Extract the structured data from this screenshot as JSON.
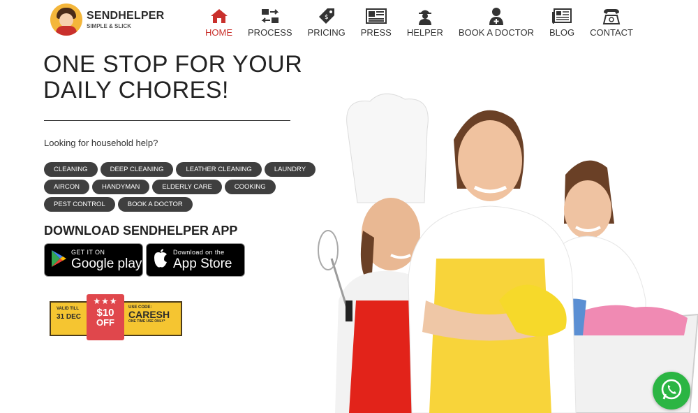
{
  "brand": {
    "name": "SENDHELPER",
    "tagline": "SIMPLE & SLICK"
  },
  "nav": {
    "items": [
      {
        "label": "HOME",
        "icon": "home-icon",
        "active": true
      },
      {
        "label": "PROCESS",
        "icon": "process-icon",
        "active": false
      },
      {
        "label": "PRICING",
        "icon": "price-tag-icon",
        "active": false
      },
      {
        "label": "PRESS",
        "icon": "newspaper-icon",
        "active": false
      },
      {
        "label": "HELPER",
        "icon": "worker-icon",
        "active": false
      },
      {
        "label": "BOOK A DOCTOR",
        "icon": "doctor-icon",
        "active": false
      },
      {
        "label": "BLOG",
        "icon": "blog-icon",
        "active": false
      },
      {
        "label": "CONTACT",
        "icon": "phone-icon",
        "active": false
      }
    ],
    "active_color": "#c9302c"
  },
  "hero": {
    "title_line1": "ONE STOP FOR YOUR",
    "title_line2": "DAILY CHORES!",
    "subtitle": "Looking for household help?"
  },
  "services": [
    "CLEANING",
    "DEEP CLEANING",
    "LEATHER CLEANING",
    "LAUNDRY",
    "AIRCON",
    "HANDYMAN",
    "ELDERLY CARE",
    "COOKING",
    "PEST CONTROL",
    "BOOK A DOCTOR"
  ],
  "download": {
    "title": "DOWNLOAD SENDHELPER APP",
    "google_play": {
      "small": "GET IT ON",
      "big": "Google play"
    },
    "app_store": {
      "small": "Download on the",
      "big": "App Store"
    }
  },
  "promo": {
    "valid_label": "VALID TILL",
    "valid_date": "31 DEC",
    "amount": "$10",
    "off": "OFF",
    "code_label": "USE CODE:",
    "code": "CARESH",
    "code_note": "ONE TIME USE ONLY*",
    "colors": {
      "bar": "#f5c531",
      "ribbon": "#e0474c"
    }
  },
  "whatsapp": {
    "icon": "whatsapp-icon",
    "color": "#2bb543"
  }
}
